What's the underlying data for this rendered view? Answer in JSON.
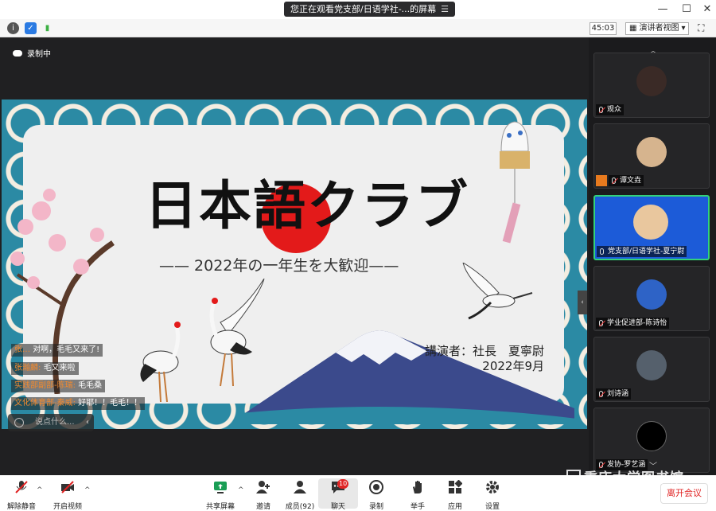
{
  "titlebar": {
    "share_text": "您正在观看党支部/日语学社-...的屏幕",
    "menu_icon": "menu-icon"
  },
  "statusbar": {
    "timer": "45:03",
    "view_mode": "演讲者视图"
  },
  "main": {
    "recording_label": "录制中"
  },
  "slide": {
    "title": "日本語クラブ",
    "subtitle": "—— 2022年の一年生を大歓迎——",
    "lecturer_line1": "講演者：社長　夏寧尉",
    "lecturer_line2": "2022年9月",
    "sun_color": "#e31a1a"
  },
  "chat": {
    "messages": [
      {
        "who": "张…",
        "text": "对啊，毛毛又来了!"
      },
      {
        "who": "张瀚麟:",
        "text": "毛又来啦"
      },
      {
        "who": "实践部副部-陈瑞:",
        "text": "毛毛桑"
      },
      {
        "who": "文化体育部-秦威:",
        "text": "好耶！！毛毛！！"
      }
    ],
    "input_placeholder": "说点什么..."
  },
  "participants": [
    {
      "name": "观众",
      "muted": true,
      "host": false,
      "avatar_color": "#3a2a26"
    },
    {
      "name": "谭文垚",
      "muted": true,
      "host": true,
      "avatar_color": "#d6b48e"
    },
    {
      "name": "党支部/日语学社-夏宁尉",
      "muted": false,
      "host": false,
      "avatar_color": "#e9c79e"
    },
    {
      "name": "学业促进部-陈诗怡",
      "muted": true,
      "host": false,
      "avatar_color": "#2e63c6"
    },
    {
      "name": "刘诗涵",
      "muted": true,
      "host": false,
      "avatar_color": "#55606c"
    },
    {
      "name": "发协-罗艺涵",
      "muted": true,
      "host": false,
      "avatar_color": "#000000"
    }
  ],
  "toolbar": {
    "unmute": "解除静音",
    "start_video": "开启视频",
    "share_screen": "共享屏幕",
    "invite": "邀请",
    "members": "成员(92)",
    "chat": "聊天",
    "chat_badge": "10",
    "record": "录制",
    "raise_hand": "举手",
    "apps": "应用",
    "settings": "设置",
    "leave": "离开会议"
  },
  "watermark": "重庆大学图书馆",
  "colors": {
    "accent_green": "#33d17a",
    "danger": "#e02424",
    "wave_blue": "#2b8aa4"
  }
}
